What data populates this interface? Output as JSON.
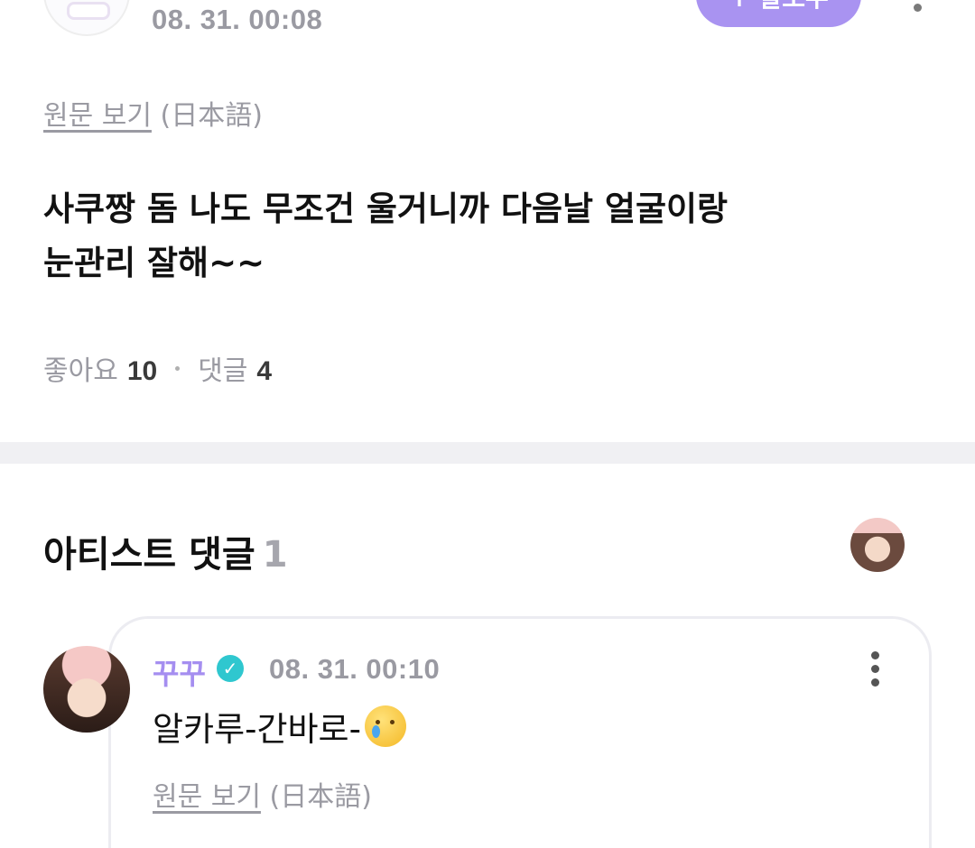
{
  "post": {
    "time": "08. 31. 00:08",
    "follow_label": "+ 팔로우",
    "translate": {
      "link": "원문 보기",
      "lang": "(日本語)"
    },
    "text_line1": "사쿠짱 돔 나도 무조건 울거니까 다음날 얼굴이랑",
    "text_line2": "눈관리 잘해~~",
    "likes_label": "좋아요",
    "likes_count": "10",
    "comments_label": "댓글",
    "comments_count": "4"
  },
  "artist_comments": {
    "title": "아티스트 댓글",
    "count": "1"
  },
  "comment": {
    "author": "꾸꾸",
    "verified_icon": "check-badge-icon",
    "time": "08. 31. 00:10",
    "text": "알카루-간바로-",
    "emoji": "crying-face-emoji",
    "translate": {
      "link": "원문 보기",
      "lang": "(日本語)"
    }
  },
  "colors": {
    "accent": "#a993f1",
    "author": "#a58ef0",
    "verified": "#2fc7cf",
    "muted": "#9a9aa2"
  }
}
